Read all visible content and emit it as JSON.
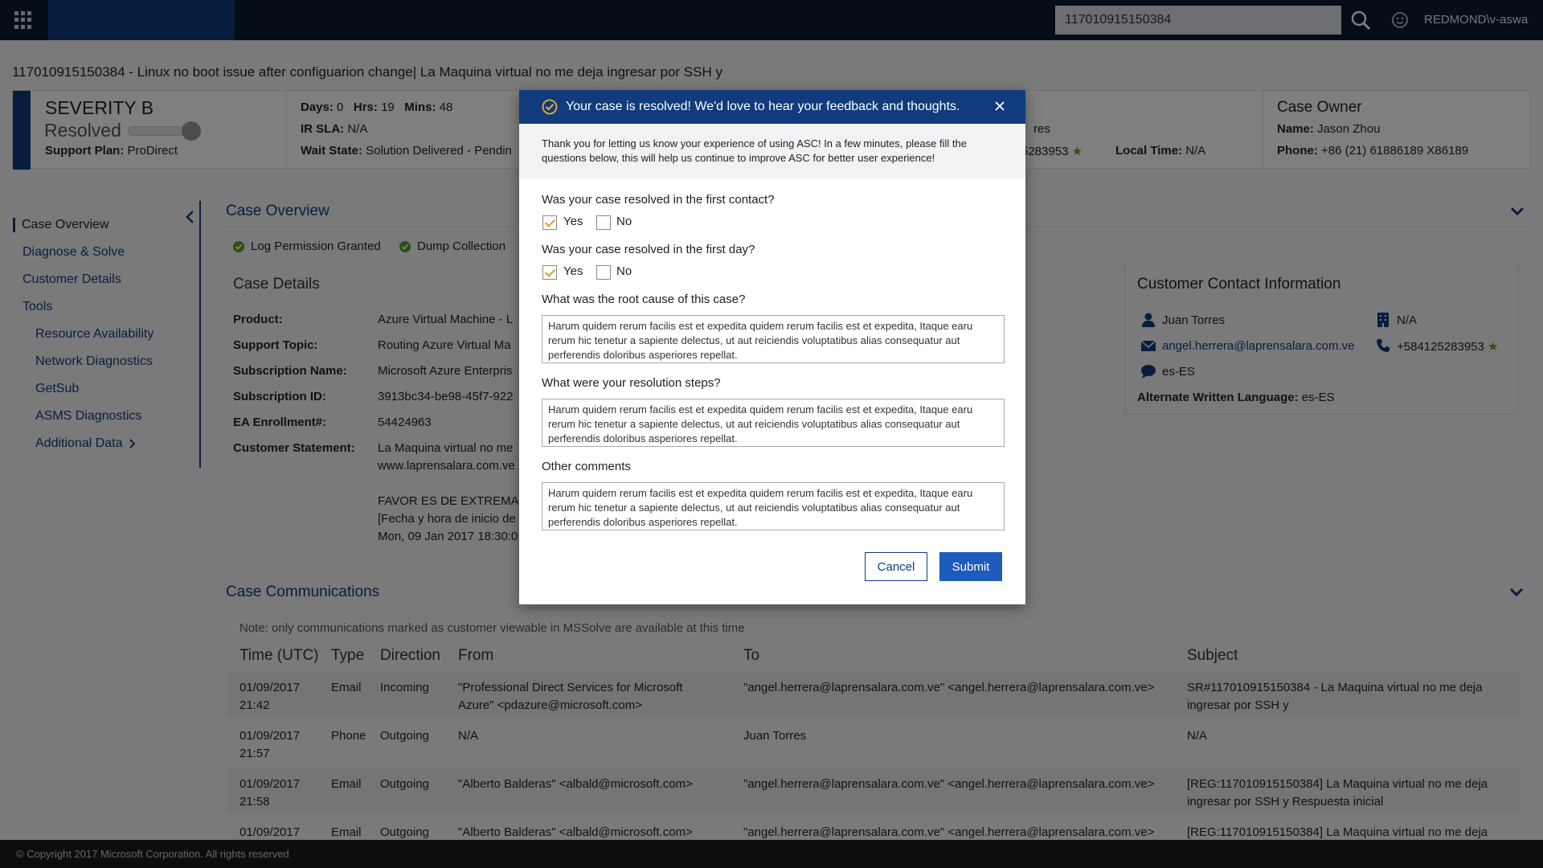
{
  "topbar": {
    "search_value": "117010915150384",
    "user": "REDMOND\\v-aswa",
    "search_icon": "search-icon",
    "feedback_icon": "smiley-icon"
  },
  "case": {
    "title": "117010915150384 - Linux no boot issue after configuarion change| La Maquina virtual no me deja ingresar por SSH y"
  },
  "info": {
    "severity": "SEVERITY B",
    "status": "Resolved",
    "plan_label": "Support Plan:",
    "plan_value": "ProDirect",
    "days_label": "Days:",
    "days": "0",
    "hrs_label": "Hrs:",
    "hrs": "19",
    "mins_label": "Mins:",
    "mins": "48",
    "ir_sla_label": "IR SLA:",
    "ir_sla": "N/A",
    "wait_label": "Wait State:",
    "wait_value": "Solution Delivered - Pendin",
    "contact_partial_1": "res",
    "contact_partial_2": "5283953",
    "local_time_label": "Local Time:",
    "local_time": "N/A",
    "owner_title": "Case Owner",
    "owner_name_label": "Name:",
    "owner_name": "Jason Zhou",
    "owner_phone_label": "Phone:",
    "owner_phone": "+86 (21) 61886189 X86189"
  },
  "nav": {
    "items": [
      {
        "label": "Case Overview"
      },
      {
        "label": "Diagnose & Solve"
      },
      {
        "label": "Customer Details"
      },
      {
        "label": "Tools"
      },
      {
        "label": "Resource Availability"
      },
      {
        "label": "Network Diagnostics"
      },
      {
        "label": "GetSub"
      },
      {
        "label": "ASMS Diagnostics"
      },
      {
        "label": "Additional Data"
      }
    ]
  },
  "overview": {
    "title": "Case Overview",
    "perm1": "Log Permission Granted",
    "perm2": "Dump Collection",
    "details_title": "Case Details",
    "fields": [
      {
        "label": "Product:",
        "value": "Azure Virtual Machine - L"
      },
      {
        "label": "Support Topic:",
        "value": "Routing Azure Virtual Ma"
      },
      {
        "label": "Subscription Name:",
        "value": "Microsoft Azure Enterpris"
      },
      {
        "label": "Subscription ID:",
        "value": "3913bc34-be98-45f7-922"
      },
      {
        "label": "EA Enrollment#:",
        "value": "54424963"
      },
      {
        "label": "Customer Statement:",
        "value": "La Maquina virtual no me"
      }
    ],
    "statement_lines": [
      "www.laprensalara.com.ve",
      "FAVOR ES DE EXTREMA U",
      "[Fecha y hora de inicio de",
      "Mon, 09 Jan 2017 18:30:0"
    ]
  },
  "contact": {
    "title": "Customer Contact Information",
    "name": "Juan Torres",
    "company": "N/A",
    "email": "angel.herrera@laprensalara.com.ve",
    "phone": "+584125283953",
    "language": "es-ES",
    "alt_lang_label": "Alternate Written Language:",
    "alt_lang": "es-ES"
  },
  "comms": {
    "title": "Case Communications",
    "note": "Note: only communications marked as customer viewable in MSSolve are available at this time",
    "headers": [
      "Time (UTC)",
      "Type",
      "Direction",
      "From",
      "To",
      "Subject"
    ],
    "rows": [
      {
        "date": "01/09/2017",
        "time": "21:42",
        "type": "Email",
        "direction": "Incoming",
        "from1": "\"Professional Direct Services for Microsoft",
        "from2": "Azure\" <pdazure@microsoft.com>",
        "to": "\"angel.herrera@laprensalara.com.ve\" <angel.herrera@laprensalara.com.ve>",
        "subject1": "SR#117010915150384 - La Maquina virtual no me deja",
        "subject2": "ingresar por SSH y"
      },
      {
        "date": "01/09/2017",
        "time": "21:57",
        "type": "Phone",
        "direction": "Outgoing",
        "from1": "N/A",
        "from2": "",
        "to": "Juan Torres",
        "subject1": "N/A",
        "subject2": ""
      },
      {
        "date": "01/09/2017",
        "time": "21:58",
        "type": "Email",
        "direction": "Outgoing",
        "from1": "\"Alberto Balderas\" <albald@microsoft.com>",
        "from2": "",
        "to": "\"angel.herrera@laprensalara.com.ve\" <angel.herrera@laprensalara.com.ve>",
        "subject1": "[REG:117010915150384] La Maquina virtual no me deja",
        "subject2": "ingresar por SSH y Respuesta inicial"
      },
      {
        "date": "01/09/2017",
        "time": "",
        "type": "Email",
        "direction": "Outgoing",
        "from1": "\"Alberto Balderas\" <albald@microsoft.com>",
        "from2": "",
        "to": "\"angel.herrera@laprensalara.com.ve\" <angel.herrera@laprensalara.com.ve>",
        "subject1": "[REG:117010915150384] La Maquina virtual no me deja",
        "subject2": ""
      }
    ]
  },
  "footer": {
    "text": "© Copyright 2017 Microsoft Corporation. All rights reserved"
  },
  "modal": {
    "title": "Your case is resolved! We'd love to hear your feedback and thoughts.",
    "intro": "Thank you for letting us know your experience of using ASC! In a few minutes, please fill the questions below, this will help us continue to improve ASC for better user experience!",
    "q1": "Was your case resolved in the first contact?",
    "q2": "Was your case resolved in the first day?",
    "yes": "Yes",
    "no": "No",
    "q1_answer": "Yes",
    "q2_answer": "Yes",
    "q3": "What was the root cause of this case?",
    "q4": "What were your resolution steps?",
    "q5": "Other comments",
    "answer_text": "Harum quidem rerum facilis est et expedita quidem rerum facilis est et expedita, Itaque earu rerum hic tenetur a sapiente delectus, ut aut reiciendis voluptatibus alias consequatur aut perferendis doloribus asperiores repellat.",
    "cancel": "Cancel",
    "submit": "Submit"
  },
  "colors": {
    "brand": "#103b7c",
    "topbar": "#0b1b33",
    "accent_check": "#e09e21",
    "success": "#5a9e2a"
  }
}
